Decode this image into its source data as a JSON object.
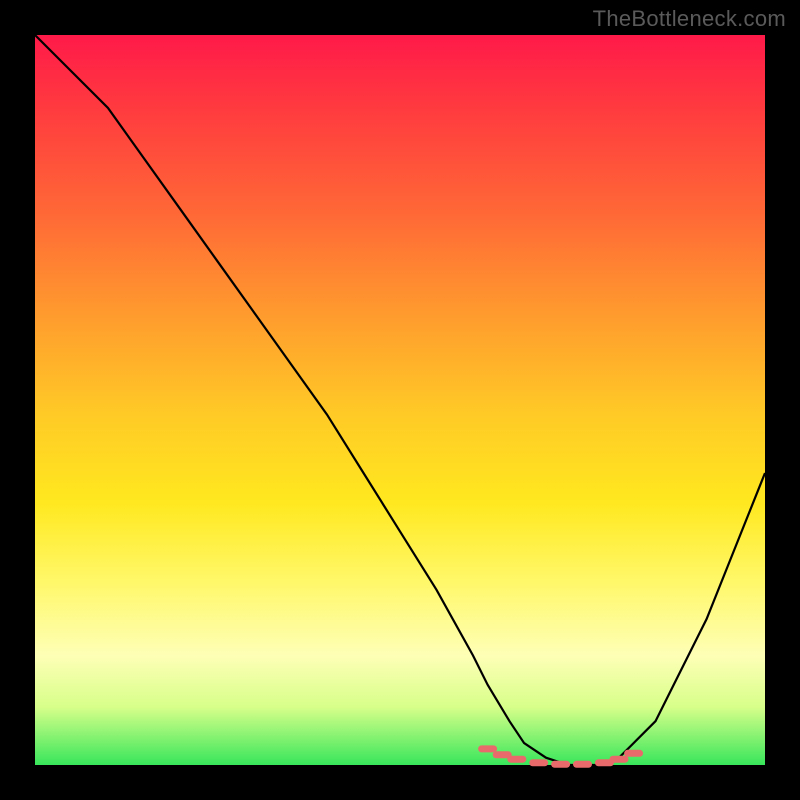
{
  "attribution": "TheBottleneck.com",
  "chart_data": {
    "type": "line",
    "title": "",
    "xlabel": "",
    "ylabel": "",
    "xlim": [
      0,
      100
    ],
    "ylim": [
      0,
      100
    ],
    "series": [
      {
        "name": "bottleneck-curve",
        "x": [
          0,
          5,
          10,
          15,
          20,
          25,
          30,
          35,
          40,
          45,
          50,
          55,
          60,
          62,
          65,
          67,
          70,
          73,
          75,
          78,
          80,
          82,
          85,
          88,
          92,
          96,
          100
        ],
        "y": [
          100,
          95,
          90,
          83,
          76,
          69,
          62,
          55,
          48,
          40,
          32,
          24,
          15,
          11,
          6,
          3,
          1,
          0,
          0,
          0,
          1,
          3,
          6,
          12,
          20,
          30,
          40
        ]
      }
    ],
    "markers": {
      "name": "optimal-range-dots",
      "x": [
        62,
        64,
        66,
        69,
        72,
        75,
        78,
        80,
        82
      ],
      "y": [
        2.2,
        1.4,
        0.8,
        0.3,
        0.1,
        0.1,
        0.3,
        0.8,
        1.6
      ]
    },
    "background_gradient_stops": [
      {
        "pos": 0,
        "color": "#ff1a49"
      },
      {
        "pos": 25,
        "color": "#ff6a36"
      },
      {
        "pos": 52,
        "color": "#ffca26"
      },
      {
        "pos": 75,
        "color": "#fff86a"
      },
      {
        "pos": 100,
        "color": "#38e65b"
      }
    ]
  }
}
